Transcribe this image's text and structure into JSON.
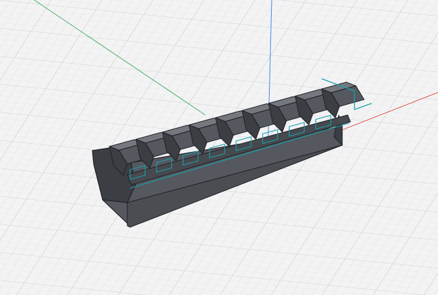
{
  "viewport": {
    "background": "#f3f3f4",
    "grid_minor_color": "#d9dbe0",
    "grid_major_color": "#c5c8cf"
  },
  "axes": {
    "x_color": "#e0544a",
    "y_color": "#49b06a",
    "z_color": "#3f86e8"
  },
  "model": {
    "name": "picatinny-rail",
    "slot_count": 9,
    "fill_dark": "#3b3e43",
    "fill_mid": "#55585e",
    "fill_light": "#75787e",
    "selection_edge_color": "#17a0ad"
  }
}
